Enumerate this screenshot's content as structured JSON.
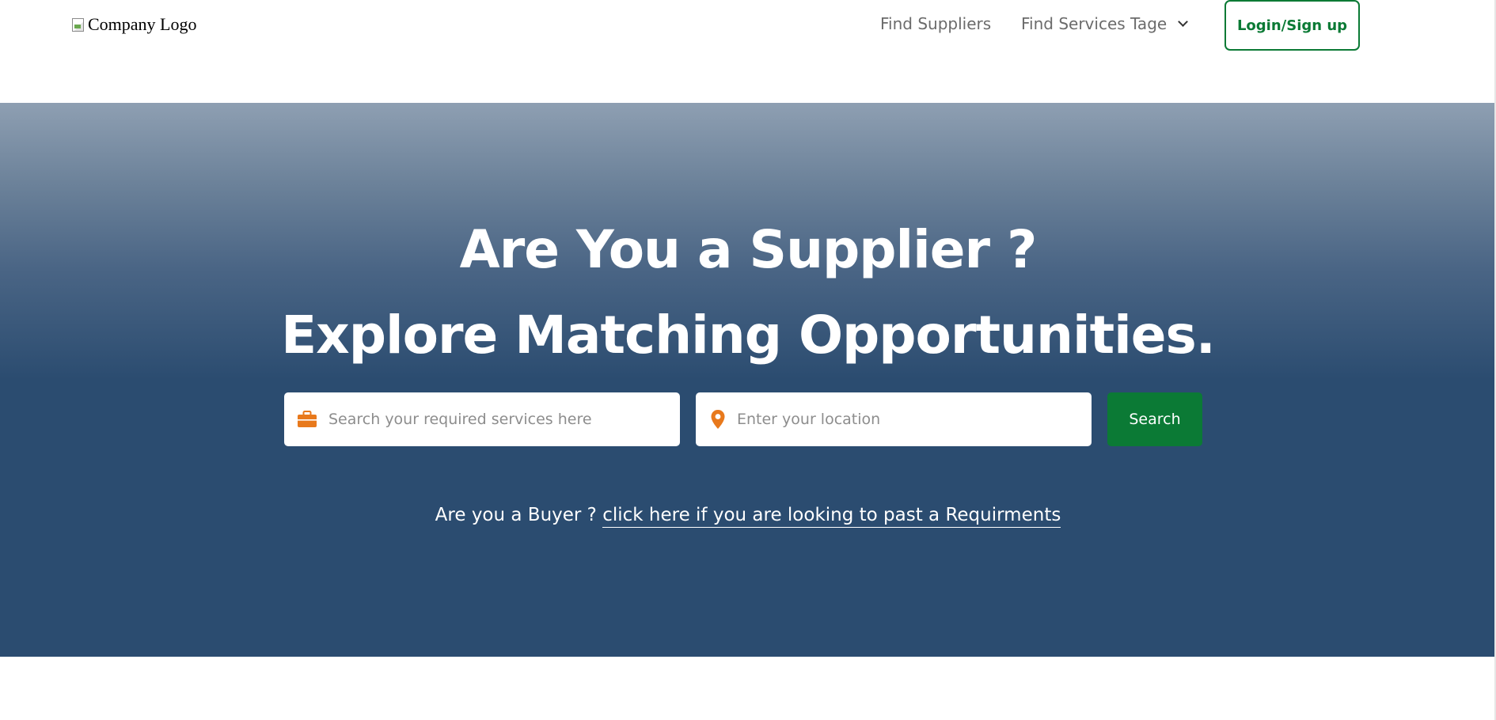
{
  "header": {
    "logo_alt": "Company Logo",
    "nav": {
      "find_suppliers": "Find Suppliers",
      "find_services": "Find Services Tage"
    },
    "login_label": "Login/Sign up"
  },
  "hero": {
    "title": "Are You a Supplier ?",
    "subtitle": "Explore Matching Opportunities.",
    "search": {
      "services_placeholder": "Search your required services here",
      "location_placeholder": "Enter your location",
      "button_label": "Search"
    },
    "buyer_prompt": "Are you a Buyer ?",
    "buyer_link": "click here if you are looking to past a Requirments"
  },
  "icons": {
    "services": "briefcase-icon",
    "location": "map-pin-icon",
    "dropdown": "chevron-down-icon"
  },
  "colors": {
    "brand_green": "#0b7a35",
    "hero_dark": "#2b4c70",
    "icon_orange": "#e8791c"
  }
}
